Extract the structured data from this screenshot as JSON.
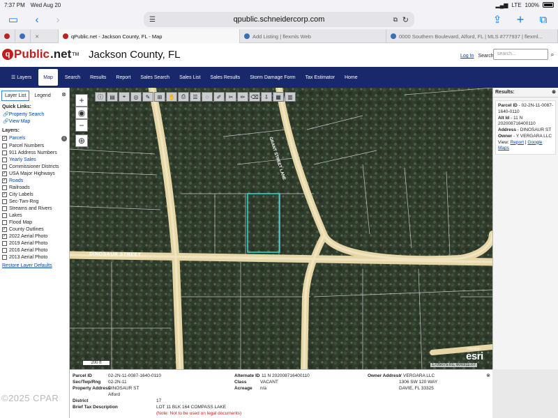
{
  "status_bar": {
    "time": "7:37 PM",
    "date": "Wed Aug 20",
    "signal": "LTE",
    "battery": "100%"
  },
  "browser": {
    "url": "qpublic.schneidercorp.com",
    "tabs": [
      {
        "label": "",
        "active": false
      },
      {
        "label": "",
        "active": false
      },
      {
        "label": "",
        "active": false
      },
      {
        "label": "qPublic.net - Jackson County, FL - Map",
        "active": true
      },
      {
        "label": "Add Listing | flexmls Web",
        "active": false
      },
      {
        "label": "0000 Southern Boulevard, Alford, FL | MLS #777937 | flexml...",
        "active": false
      }
    ]
  },
  "site": {
    "logo_q": "q",
    "logo_public": "Public",
    "logo_net": ".net",
    "logo_tm": "TM",
    "county": "Jackson County, FL",
    "login": "Log In",
    "search_label": "Search",
    "search_placeholder": "search..."
  },
  "nav": {
    "items": [
      "Layers",
      "Map",
      "Search",
      "Results",
      "Report",
      "Sales Search",
      "Sales List",
      "Sales Results",
      "Storm Damage Form",
      "Tax Estimator",
      "Home"
    ]
  },
  "left_panel": {
    "tabs": [
      "Layer List",
      "Legend"
    ],
    "quick_links_title": "Quick Links:",
    "quick_links": [
      "Property Search",
      "View Map"
    ],
    "layers_title": "Layers:",
    "layers": [
      {
        "name": "Parcels",
        "checked": true,
        "link": true
      },
      {
        "name": "Parcel Numbers",
        "checked": false,
        "link": false
      },
      {
        "name": "911 Address Numbers",
        "checked": false,
        "link": false
      },
      {
        "name": "Yearly Sales",
        "checked": false,
        "link": true
      },
      {
        "name": "Commissioner Districts",
        "checked": false,
        "link": false
      },
      {
        "name": "USA Major Highways",
        "checked": true,
        "link": false
      },
      {
        "name": "Roads",
        "checked": true,
        "link": true
      },
      {
        "name": "Railroads",
        "checked": false,
        "link": false
      },
      {
        "name": "City Labels",
        "checked": true,
        "link": false
      },
      {
        "name": "Sec-Twn-Rng",
        "checked": false,
        "link": false
      },
      {
        "name": "Streams and Rivers",
        "checked": false,
        "link": false
      },
      {
        "name": "Lakes",
        "checked": false,
        "link": false
      },
      {
        "name": "Flood Map",
        "checked": false,
        "link": false
      },
      {
        "name": "County Outlines",
        "checked": true,
        "link": false
      },
      {
        "name": "2022 Aerial Photo",
        "checked": true,
        "link": false
      },
      {
        "name": "2019 Aerial Photo",
        "checked": false,
        "link": false
      },
      {
        "name": "2016 Aerial Photo",
        "checked": false,
        "link": false
      },
      {
        "name": "2013 Aerial Photo",
        "checked": false,
        "link": false
      }
    ],
    "restore_label": "Restore Layer Defaults"
  },
  "map": {
    "road_labels": {
      "street1": "DINOSAUR STREET",
      "street2": "GRANT STREET LANE"
    },
    "scale_label": "200 ft",
    "coords": "1705075.01, 600311.07",
    "esri_label": "esri",
    "esri_powered": "POWERED BY"
  },
  "results": {
    "title": "Results:",
    "parcel_id_label": "Parcel ID",
    "parcel_id": "02-2N-11-0087-1640-0110",
    "alt_id_label": "Alt Id",
    "alt_id": "11 N 202008716400110",
    "address_label": "Address",
    "address": "DINOSAUR ST",
    "owner_label": "Owner",
    "owner": "Y VERGARA LLC",
    "view_label": "View:",
    "report_link": "Report",
    "google_link": "Google Maps"
  },
  "detail": {
    "parcel_id_label": "Parcel ID",
    "parcel_id": "02-2N-11-0087-1640-0110",
    "sec_label": "Sec/Twp/Rng",
    "sec": "02-2N-11",
    "prop_addr_label": "Property Address",
    "prop_addr_1": "DINOSAUR ST",
    "prop_addr_2": "Alford",
    "district_label": "District",
    "district": "17",
    "brief_label": "Brief Tax Description",
    "brief": "LOT 11 BLK 164 COMPASS LAKE",
    "note": "(Note: Not to be used on legal documents)",
    "alt_label": "Alternate ID",
    "alt": "11 N 202008716400110",
    "class_label": "Class",
    "class": "VACANT",
    "acreage_label": "Acreage",
    "acreage": "n/a",
    "owner_label": "Owner Address",
    "owner_1": "Y VERGARA LLC",
    "owner_2": "1306 SW 120 WAY",
    "owner_3": "DAVIE, FL 33325"
  },
  "watermark": "©2025 CPAR",
  "colors": {
    "nav_bg": "#17296b",
    "brand_red": "#c21e1e",
    "link": "#0645ad",
    "parcel_outline": "#34d8d0",
    "road": "#e7d7a6"
  }
}
